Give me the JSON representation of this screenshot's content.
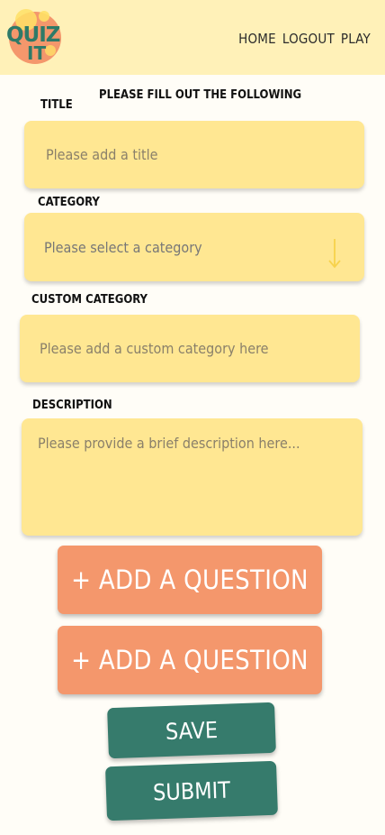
{
  "header": {
    "logo_text": "QUIZ IT",
    "nav": [
      {
        "label": "HOME"
      },
      {
        "label": "LOGOUT"
      },
      {
        "label": "PLAY"
      }
    ]
  },
  "form": {
    "subtitle": "PLEASE FILL OUT THE FOLLOWING",
    "title": {
      "label": "TITLE",
      "placeholder": "Please add a title"
    },
    "category": {
      "label": "CATEGORY",
      "placeholder": "Please select a category"
    },
    "custom_category": {
      "label": "CUSTOM CATEGORY",
      "placeholder": "Please add a custom category here"
    },
    "description": {
      "label": "DESCRIPTION",
      "placeholder": "Please provide a brief description here..."
    }
  },
  "actions": {
    "add_question_1": "+ ADD A QUESTION",
    "add_question_2": "+ ADD A QUESTION",
    "save": "SAVE",
    "submit": "SUBMIT"
  },
  "colors": {
    "header_bg": "#fff1b8",
    "field_bg": "#ffe792",
    "question_button": "#f4976c",
    "save_button": "#367b6c",
    "logo_text": "#2e7a68",
    "logo_circle": "#f4976c"
  }
}
